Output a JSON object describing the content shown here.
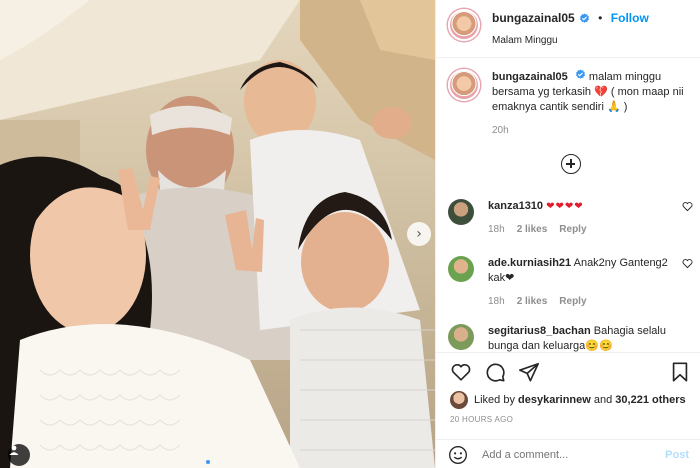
{
  "header": {
    "username": "bungazainal05",
    "follow_label": "Follow",
    "separator": "•",
    "location": "Malam Minggu"
  },
  "caption": {
    "username": "bungazainal05",
    "text": "malam minggu bersama yg terkasih 💔 ( mon maap nii emaknya cantik sendiri 🙏 )",
    "time": "20h"
  },
  "comments": [
    {
      "username": "kanza1310",
      "text": "❤❤❤❤",
      "time": "18h",
      "likes": "2 likes",
      "reply": "Reply"
    },
    {
      "username": "ade.kurniasih21",
      "text": "Anak2ny Ganteng2 kak❤",
      "time": "18h",
      "likes": "2 likes",
      "reply": "Reply"
    },
    {
      "username": "segitarius8_bachan",
      "text": "Bahagia selalu bunga dan keluarga😊😊",
      "time": "",
      "likes": "",
      "reply": ""
    }
  ],
  "likes": {
    "prefix": "Liked by",
    "user": "desykarinnew",
    "and": "and",
    "count": "30,221 others"
  },
  "timestamp": "20 HOURS AGO",
  "add_comment": {
    "placeholder": "Add a comment...",
    "post_label": "Post"
  },
  "colors": {
    "accent": "#0095f6",
    "heart": "#e01c2c",
    "muted": "#8e8e8e"
  }
}
